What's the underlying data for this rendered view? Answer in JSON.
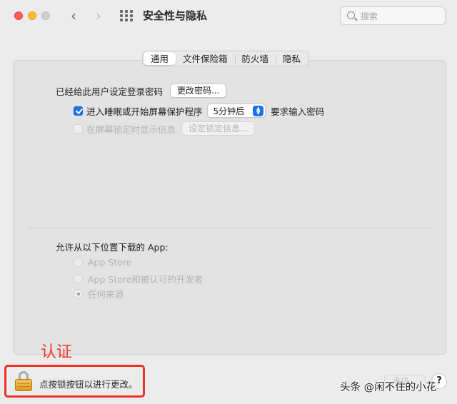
{
  "titlebar": {
    "title": "安全性与隐私",
    "back_glyph": "‹",
    "forward_glyph": "›",
    "search_placeholder": "搜索"
  },
  "tabs": [
    {
      "label": "通用",
      "active": true
    },
    {
      "label": "文件保险箱",
      "active": false
    },
    {
      "label": "防火墙",
      "active": false
    },
    {
      "label": "隐私",
      "active": false
    }
  ],
  "general": {
    "login_password_label": "已经给此用户设定登录密码",
    "change_password_button": "更改密码...",
    "require_password": {
      "checked": true,
      "label_before": "进入睡眠或开始屏幕保护程序",
      "delay_value": "5分钟后",
      "label_after": "要求输入密码"
    },
    "lock_message": {
      "checked": false,
      "enabled": false,
      "label": "在屏幕锁定时显示信息",
      "button": "设定锁定信息..."
    }
  },
  "downloads": {
    "heading": "允许从以下位置下载的 App:",
    "options": [
      {
        "label": "App Store",
        "selected": false,
        "enabled": false
      },
      {
        "label": "App Store和被认可的开发者",
        "selected": false,
        "enabled": false
      },
      {
        "label": "任何来源",
        "selected": true,
        "enabled": false
      }
    ]
  },
  "footer": {
    "lock_text": "点按锁按钮以进行更改。",
    "advanced_button": "高级...",
    "help_button": "?"
  },
  "annotation": {
    "label": "认证",
    "color": "#ee3a2d"
  },
  "watermark": "头条 @闲不住的小花",
  "colors": {
    "accent": "#1a73e8",
    "highlight_box": "#ea3323"
  }
}
